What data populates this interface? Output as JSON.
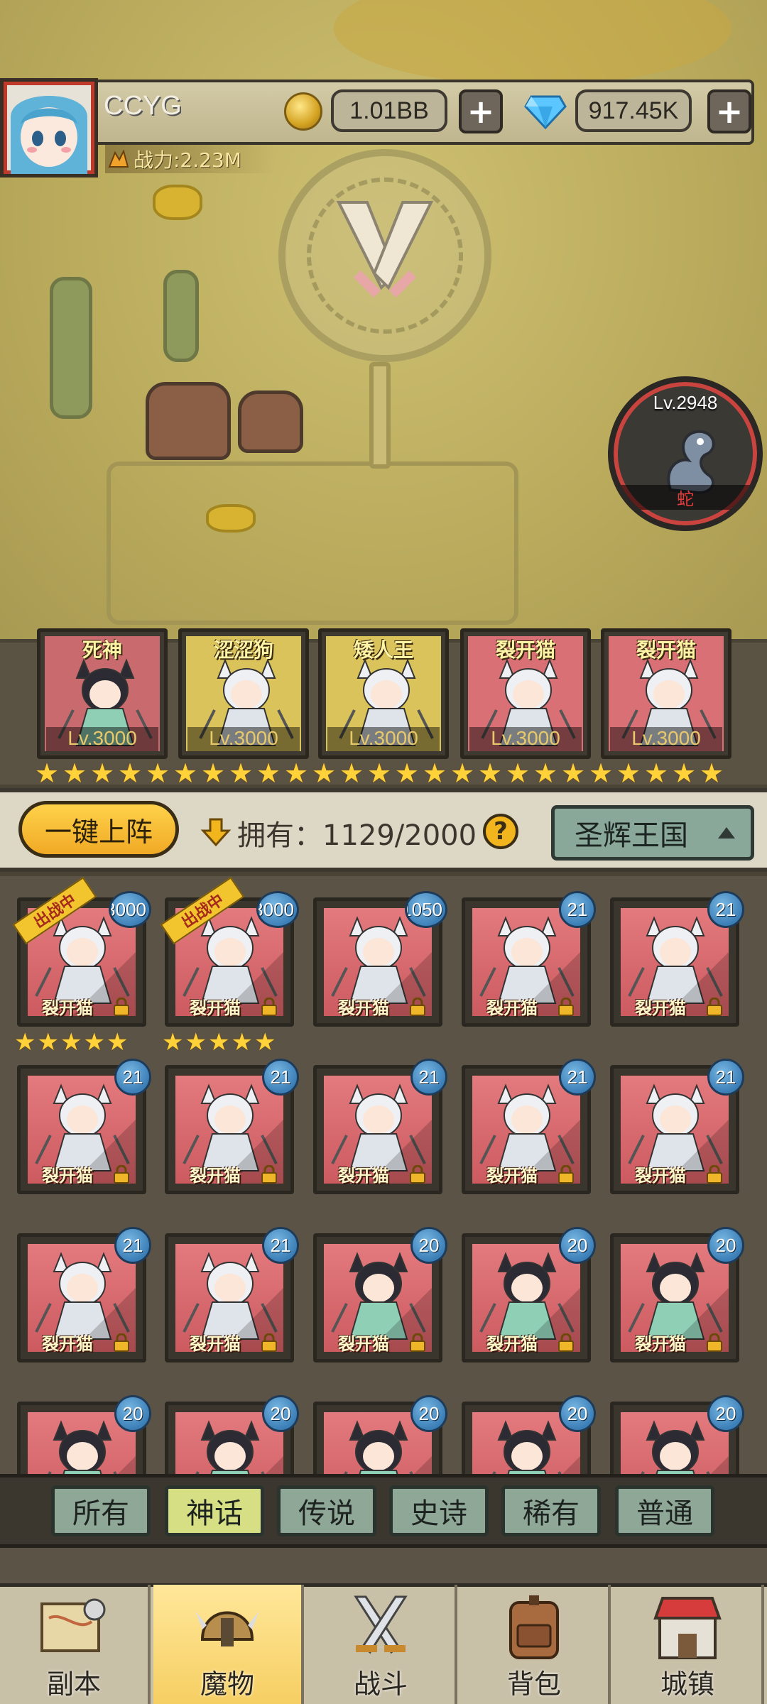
{
  "player": {
    "name": "CCYG",
    "power": "战力:2.23M",
    "gold": "1.01BB",
    "diamonds": "917.45K"
  },
  "boss": {
    "level": "Lv.2948",
    "name": "蛇"
  },
  "team": [
    {
      "name": "死神",
      "level": "Lv.3000",
      "color": "#c96a6e"
    },
    {
      "name": "涩涩狗",
      "level": "Lv.3000",
      "color": "#d9c35a"
    },
    {
      "name": "矮人王",
      "level": "Lv.3000",
      "color": "#d9c35a"
    },
    {
      "name": "裂开猫",
      "level": "Lv.3000",
      "color": "#d87075"
    },
    {
      "name": "裂开猫",
      "level": "Lv.3000",
      "color": "#d87075"
    }
  ],
  "team_star_count": 25,
  "toolbar": {
    "deploy_label": "一键上阵",
    "owned_label": "拥有：1129/2000",
    "help": "?",
    "kingdom": "圣辉王国"
  },
  "deployed_tag": "出战中",
  "monsters": [
    {
      "name": "裂开猫",
      "level": "3000",
      "deployed": true,
      "stars": 5,
      "hero": "white"
    },
    {
      "name": "裂开猫",
      "level": "3000",
      "deployed": true,
      "stars": 5,
      "hero": "white"
    },
    {
      "name": "裂开猫",
      "level": "1050",
      "deployed": false,
      "stars": 0,
      "hero": "white"
    },
    {
      "name": "裂开猫",
      "level": "21",
      "deployed": false,
      "stars": 0,
      "hero": "white"
    },
    {
      "name": "裂开猫",
      "level": "21",
      "deployed": false,
      "stars": 0,
      "hero": "white"
    },
    {
      "name": "裂开猫",
      "level": "21",
      "deployed": false,
      "stars": 0,
      "hero": "white"
    },
    {
      "name": "裂开猫",
      "level": "21",
      "deployed": false,
      "stars": 0,
      "hero": "white"
    },
    {
      "name": "裂开猫",
      "level": "21",
      "deployed": false,
      "stars": 0,
      "hero": "white"
    },
    {
      "name": "裂开猫",
      "level": "21",
      "deployed": false,
      "stars": 0,
      "hero": "white"
    },
    {
      "name": "裂开猫",
      "level": "21",
      "deployed": false,
      "stars": 0,
      "hero": "white"
    },
    {
      "name": "裂开猫",
      "level": "21",
      "deployed": false,
      "stars": 0,
      "hero": "white"
    },
    {
      "name": "裂开猫",
      "level": "21",
      "deployed": false,
      "stars": 0,
      "hero": "white"
    },
    {
      "name": "裂开猫",
      "level": "20",
      "deployed": false,
      "stars": 0,
      "hero": "black"
    },
    {
      "name": "裂开猫",
      "level": "20",
      "deployed": false,
      "stars": 0,
      "hero": "black"
    },
    {
      "name": "裂开猫",
      "level": "20",
      "deployed": false,
      "stars": 0,
      "hero": "black"
    },
    {
      "name": "",
      "level": "20",
      "deployed": false,
      "stars": 0,
      "hero": "black"
    },
    {
      "name": "",
      "level": "20",
      "deployed": false,
      "stars": 0,
      "hero": "black"
    },
    {
      "name": "",
      "level": "20",
      "deployed": false,
      "stars": 0,
      "hero": "black"
    },
    {
      "name": "",
      "level": "20",
      "deployed": false,
      "stars": 0,
      "hero": "black"
    },
    {
      "name": "",
      "level": "20",
      "deployed": false,
      "stars": 0,
      "hero": "black"
    }
  ],
  "filters": [
    {
      "label": "所有",
      "active": false
    },
    {
      "label": "神话",
      "active": true
    },
    {
      "label": "传说",
      "active": false
    },
    {
      "label": "史诗",
      "active": false
    },
    {
      "label": "稀有",
      "active": false
    },
    {
      "label": "普通",
      "active": false
    }
  ],
  "nav": [
    {
      "label": "副本",
      "icon": "map-icon",
      "active": false
    },
    {
      "label": "魔物",
      "icon": "monster-helmet-icon",
      "active": true
    },
    {
      "label": "战斗",
      "icon": "crossed-swords-icon",
      "active": false
    },
    {
      "label": "背包",
      "icon": "backpack-icon",
      "active": false
    },
    {
      "label": "城镇",
      "icon": "shop-icon",
      "active": false
    }
  ]
}
